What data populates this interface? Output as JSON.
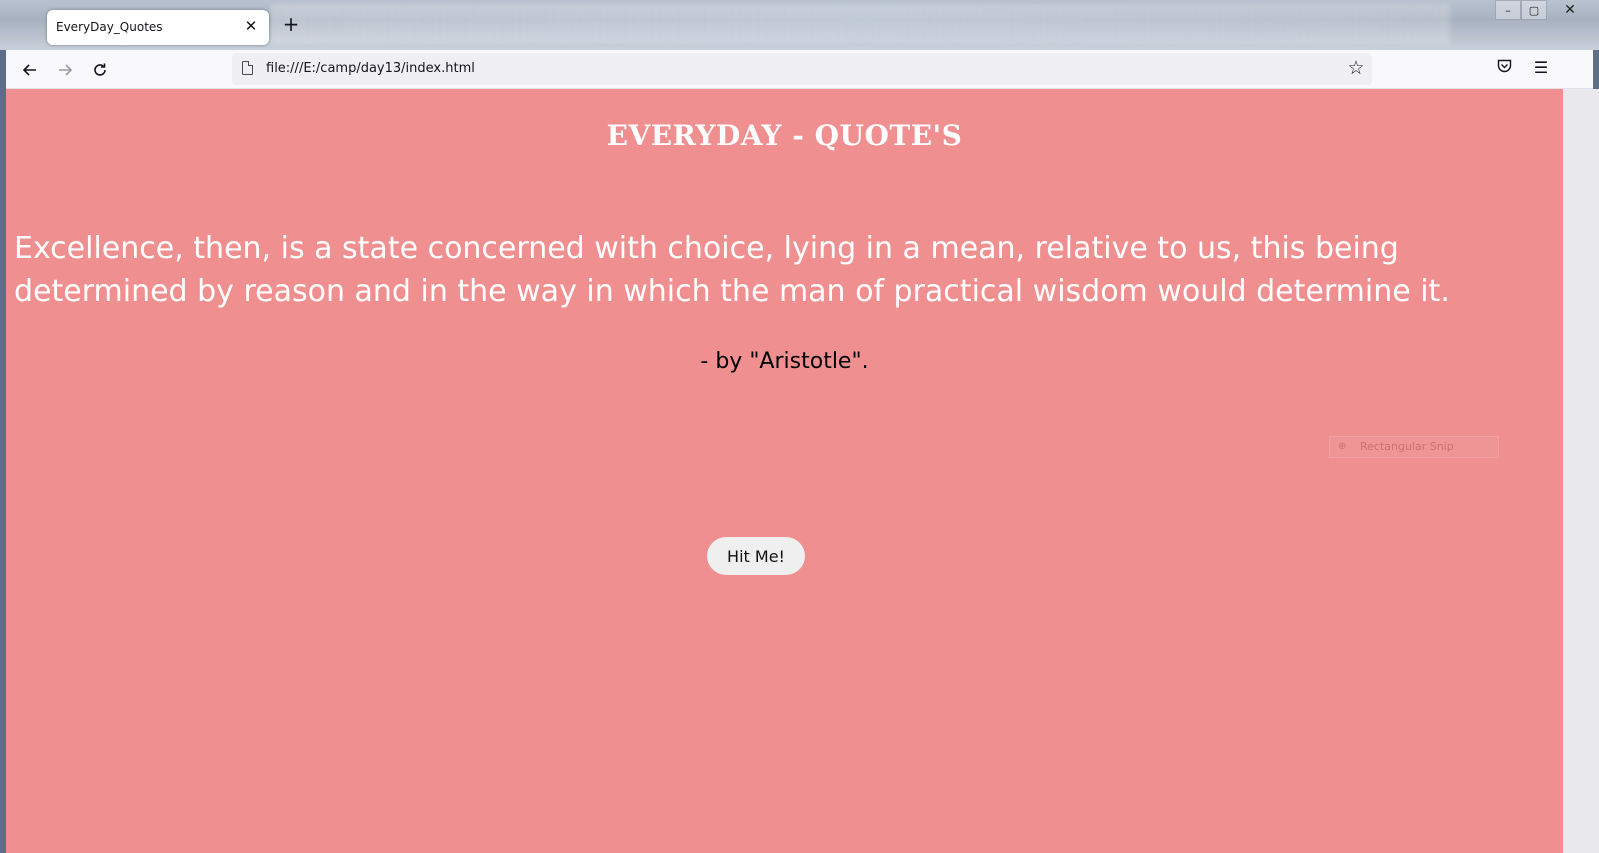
{
  "browser": {
    "tab_title": "EveryDay_Quotes",
    "tab_close_glyph": "✕",
    "new_tab_glyph": "+",
    "url": "file:///E:/camp/day13/index.html",
    "icons": {
      "back": "back-arrow-icon",
      "forward": "forward-arrow-icon",
      "reload": "reload-icon",
      "page": "page-icon",
      "bookmark": "star-icon",
      "pocket": "pocket-icon",
      "menu": "hamburger-menu-icon"
    },
    "window_controls": {
      "minimize": "–",
      "maximize": "▢",
      "close": "✕"
    }
  },
  "page": {
    "title": "EVERYDAY - QUOTE'S",
    "quote": "Excellence, then, is a state concerned with choice, lying in a mean, relative to us, this being determined by reason and in the way in which the man of practical wisdom would determine it.",
    "author": "- by \"Aristotle\".",
    "button_label": "Hit Me!",
    "background_color": "#f08f8f"
  },
  "overlay": {
    "snip_label": "Rectangular Snip"
  }
}
